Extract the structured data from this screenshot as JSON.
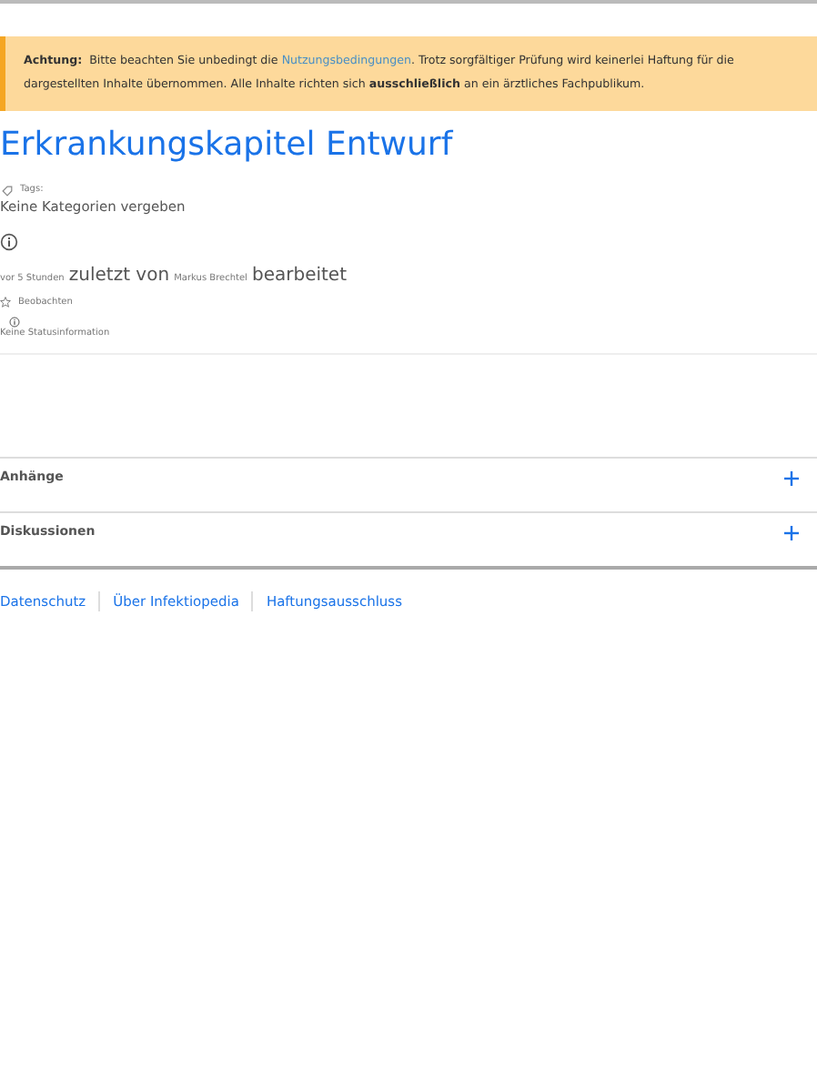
{
  "notice": {
    "label": "Achtung:",
    "before": "Bitte beachten Sie unbedingt die",
    "link": "Nutzungsbedingungen",
    "after": ". Trotz sorgfältiger Prüfung wird keinerlei Haftung für die dargestellten Inhalte übernommen. Alle Inhalte richten sich **ausschließlich** an ein ärztliches Fachpublikum."
  },
  "title": "Erkrankungskapitel Entwurf",
  "tags": {
    "label": "Tags:",
    "value": "Keine Kategorien vergeben"
  },
  "edit_info": {
    "time": "vor 5 Stunden",
    "by": "zuletzt von",
    "author": "Markus Brechtel",
    "action": "bearbeitet"
  },
  "watch": {
    "label": "Beobachten"
  },
  "status": {
    "text": "Keine Statusinformation"
  },
  "sections": [
    {
      "title": "Anhänge",
      "expanded": false
    },
    {
      "title": "Diskussionen",
      "expanded": false
    }
  ],
  "footer": [
    "Datenschutz",
    "Über Infektiopedia",
    "Haftungsausschluss"
  ]
}
